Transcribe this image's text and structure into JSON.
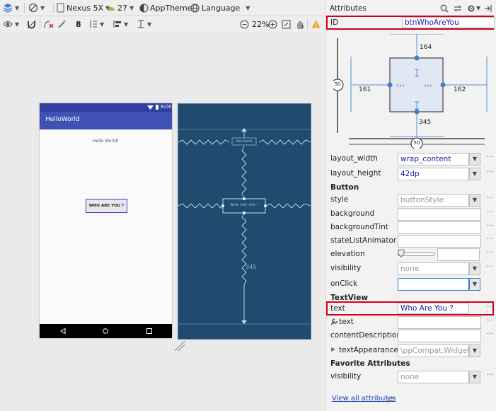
{
  "toolbar1": {
    "device": "Nexus 5X",
    "api": "27",
    "theme": "AppTheme",
    "language": "Language"
  },
  "toolbar2": {
    "margin_value": "8",
    "zoom": "22%"
  },
  "phone": {
    "time": "8:00",
    "app_title": "HelloWorld",
    "hello_text": "Hello World!",
    "button_text": "WHO ARE YOU ?"
  },
  "blueprint": {
    "small_label": "Hello World!",
    "button_text": "WHO ARE YOU ?",
    "bottom_margin": "345"
  },
  "attributes": {
    "panel_title": "Attributes",
    "id_label": "ID",
    "id_value": "btnWhoAreYou",
    "constraint": {
      "top": "164",
      "left": "161",
      "right": "162",
      "bottom": "345",
      "vertical_bias": "50",
      "horizontal_bias": "50"
    },
    "layout_width_label": "layout_width",
    "layout_width_value": "wrap_content",
    "layout_height_label": "layout_height",
    "layout_height_value": "42dp",
    "button_section": "Button",
    "style_label": "style",
    "style_value": "buttonStyle",
    "background_label": "background",
    "backgroundTint_label": "backgroundTint",
    "stateListAnimator_label": "stateListAnimator",
    "elevation_label": "elevation",
    "visibility_label": "visibility",
    "visibility_value": "none",
    "onClick_label": "onClick",
    "textview_section": "TextView",
    "text_label": "text",
    "text_value": "Who Are You ?",
    "tools_text_label": "text",
    "contentDescription_label": "contentDescription",
    "textAppearance_label": "textAppearance",
    "textAppearance_value": "\\ppCompat.Widget.Button",
    "favorite_section": "Favorite Attributes",
    "fav_visibility_label": "visibility",
    "fav_visibility_value": "none",
    "view_all": "View all attributes"
  },
  "colors": {
    "highlight": "#d0021b",
    "blueprint_bg": "#204a6e",
    "app_bar": "#3f51b5",
    "link": "#1a3fc1"
  }
}
